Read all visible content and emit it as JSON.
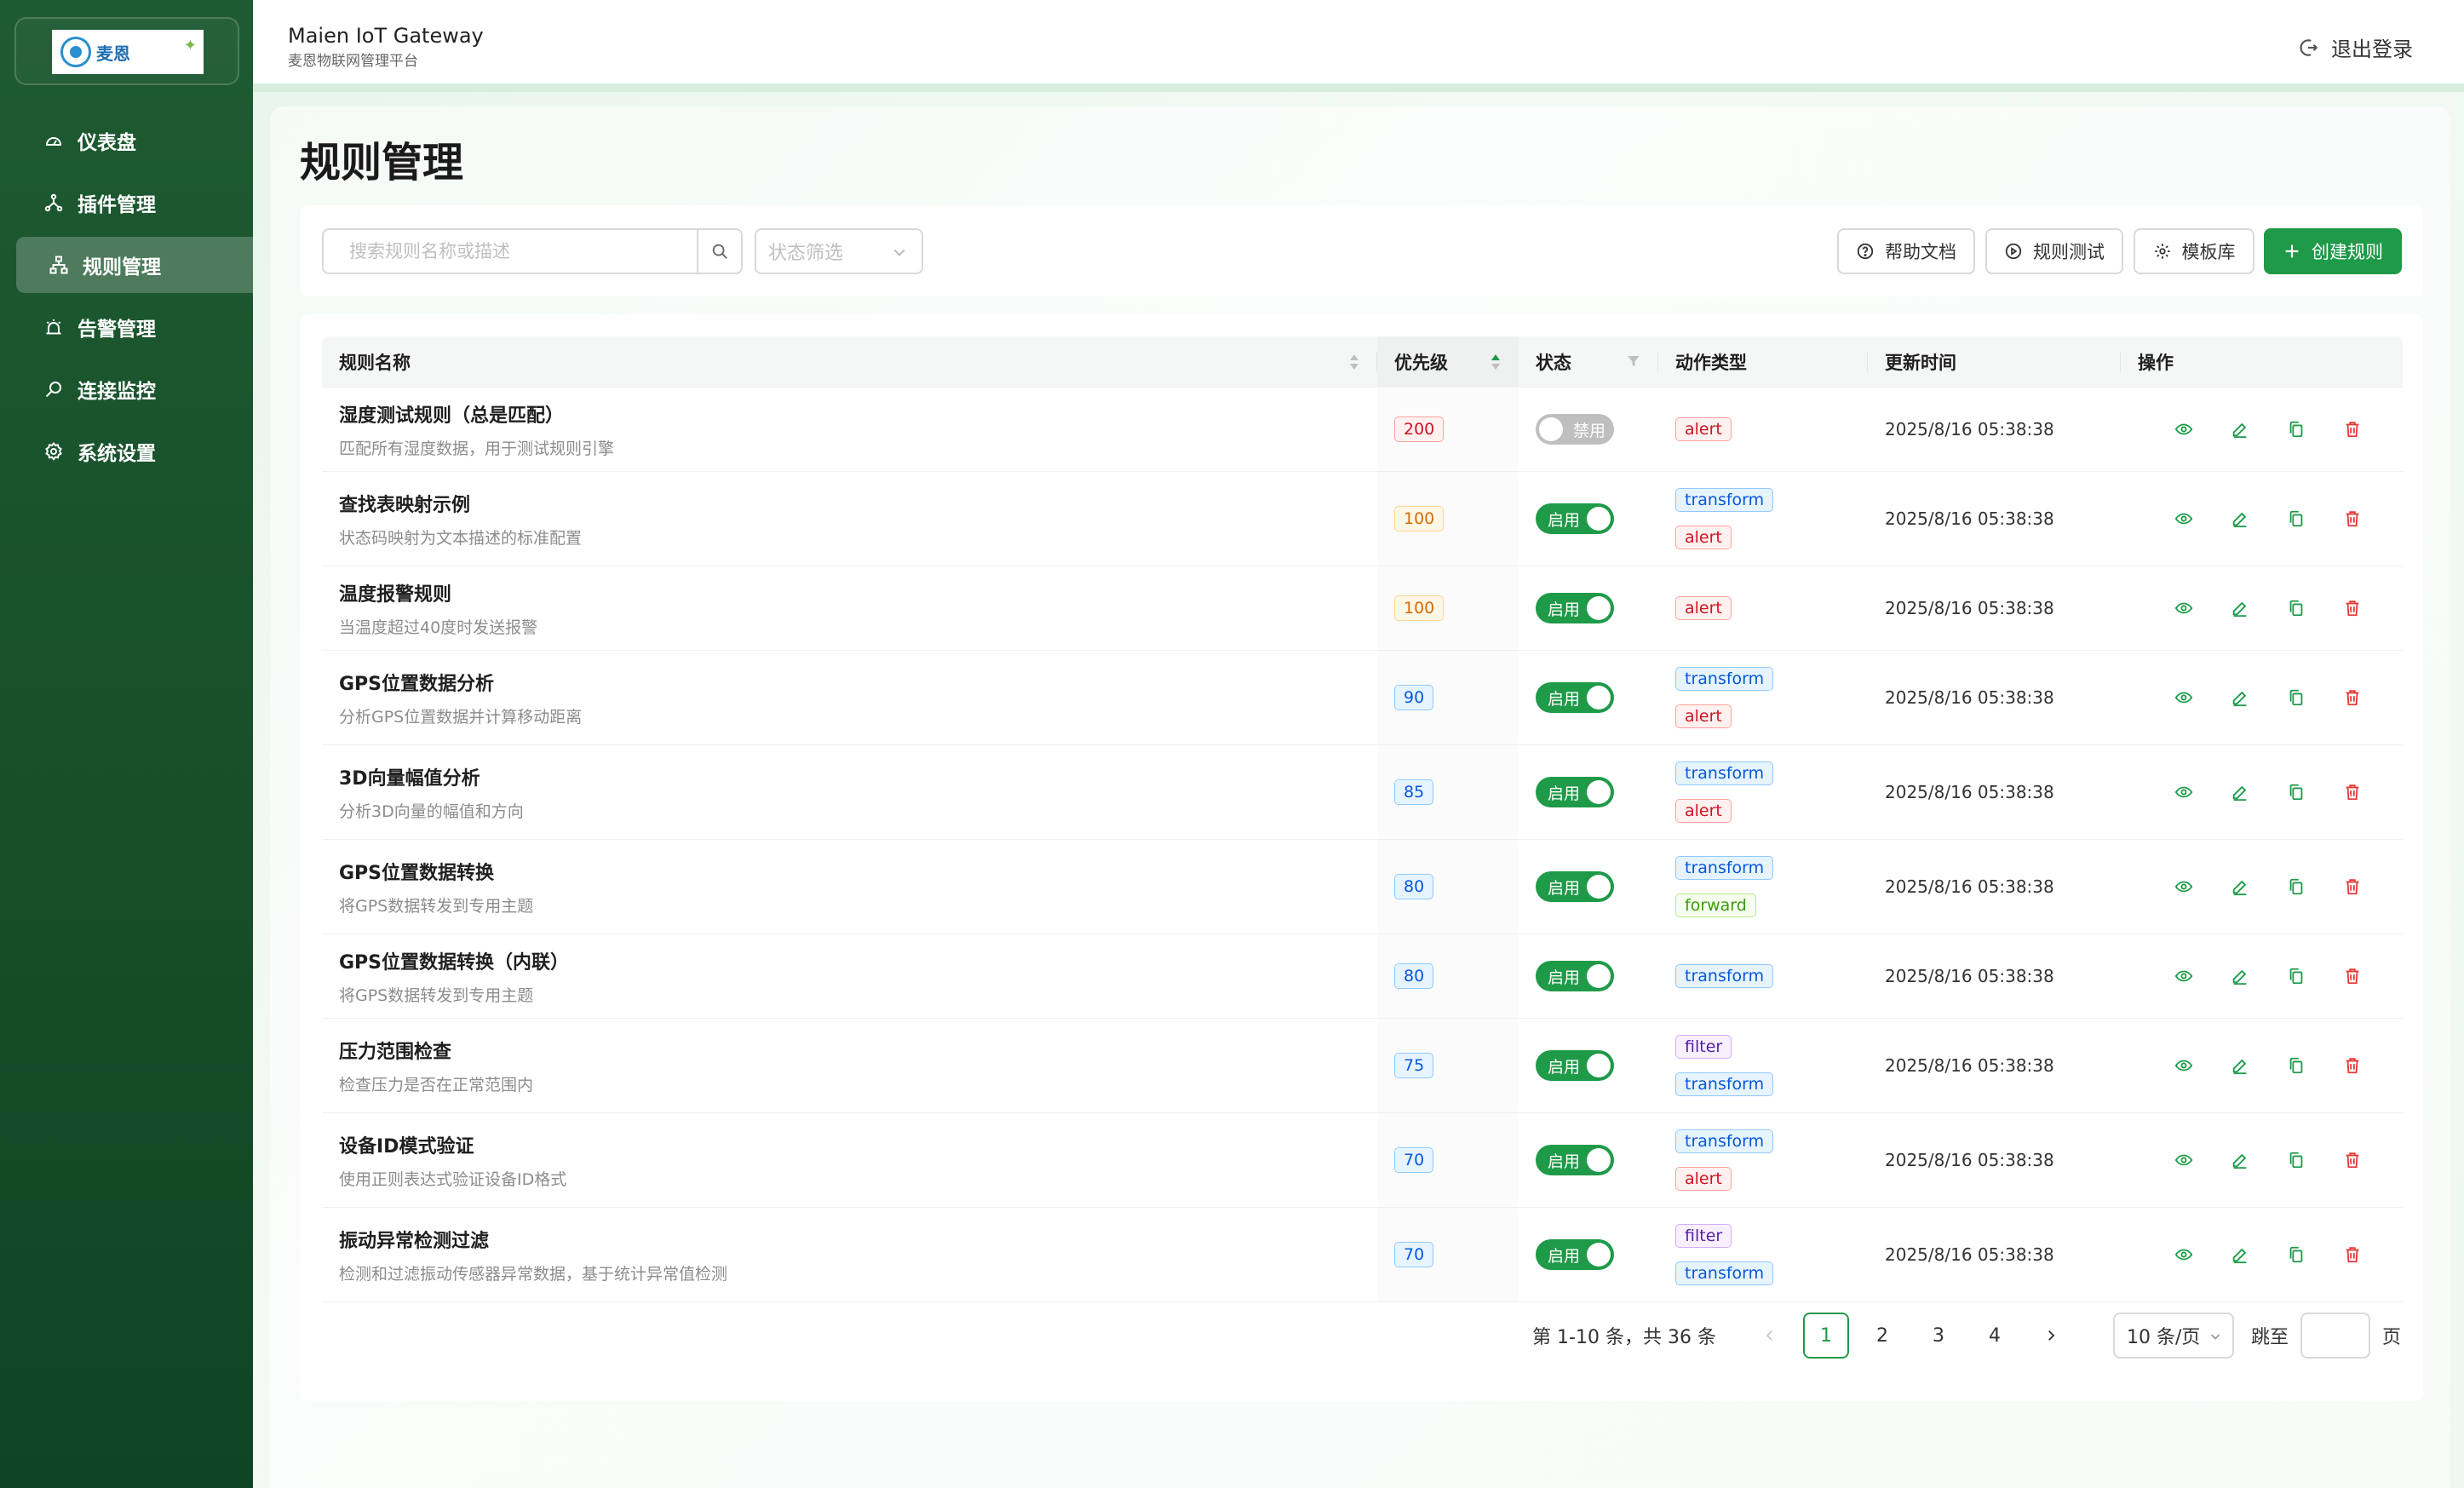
{
  "app": {
    "logo_text": "麦恩",
    "title": "Maien IoT Gateway",
    "subtitle": "麦恩物联网管理平台",
    "logout": "退出登录"
  },
  "sidebar": {
    "items": [
      {
        "label": "仪表盘",
        "icon": "dashboard-icon",
        "active": false
      },
      {
        "label": "插件管理",
        "icon": "plugin-icon",
        "active": false
      },
      {
        "label": "规则管理",
        "icon": "rules-icon",
        "active": true
      },
      {
        "label": "告警管理",
        "icon": "alarm-icon",
        "active": false
      },
      {
        "label": "连接监控",
        "icon": "monitor-icon",
        "active": false
      },
      {
        "label": "系统设置",
        "icon": "gear-icon",
        "active": false
      }
    ]
  },
  "page": {
    "title": "规则管理"
  },
  "toolbar": {
    "search_placeholder": "搜索规则名称或描述",
    "status_placeholder": "状态筛选",
    "help_label": "帮助文档",
    "test_label": "规则测试",
    "template_label": "模板库",
    "create_label": "创建规则"
  },
  "table": {
    "columns": {
      "name": "规则名称",
      "priority": "优先级",
      "status": "状态",
      "action_type": "动作类型",
      "updated": "更新时间",
      "ops": "操作"
    },
    "rows": [
      {
        "name": "湿度测试规则（总是匹配）",
        "desc": "匹配所有湿度数据，用于测试规则引擎",
        "priority": "200",
        "priority_color": "red",
        "enabled": false,
        "status_label": "禁用",
        "tags": [
          "alert"
        ],
        "updated": "2025/8/16 05:38:38"
      },
      {
        "name": "查找表映射示例",
        "desc": "状态码映射为文本描述的标准配置",
        "priority": "100",
        "priority_color": "orange",
        "enabled": true,
        "status_label": "启用",
        "tags": [
          "transform",
          "alert"
        ],
        "updated": "2025/8/16 05:38:38"
      },
      {
        "name": "温度报警规则",
        "desc": "当温度超过40度时发送报警",
        "priority": "100",
        "priority_color": "orange",
        "enabled": true,
        "status_label": "启用",
        "tags": [
          "alert"
        ],
        "updated": "2025/8/16 05:38:38"
      },
      {
        "name": "GPS位置数据分析",
        "desc": "分析GPS位置数据并计算移动距离",
        "priority": "90",
        "priority_color": "blue",
        "enabled": true,
        "status_label": "启用",
        "tags": [
          "transform",
          "alert"
        ],
        "updated": "2025/8/16 05:38:38"
      },
      {
        "name": "3D向量幅值分析",
        "desc": "分析3D向量的幅值和方向",
        "priority": "85",
        "priority_color": "blue",
        "enabled": true,
        "status_label": "启用",
        "tags": [
          "transform",
          "alert"
        ],
        "updated": "2025/8/16 05:38:38"
      },
      {
        "name": "GPS位置数据转换",
        "desc": "将GPS数据转发到专用主题",
        "priority": "80",
        "priority_color": "blue",
        "enabled": true,
        "status_label": "启用",
        "tags": [
          "transform",
          "forward"
        ],
        "updated": "2025/8/16 05:38:38"
      },
      {
        "name": "GPS位置数据转换（内联）",
        "desc": "将GPS数据转发到专用主题",
        "priority": "80",
        "priority_color": "blue",
        "enabled": true,
        "status_label": "启用",
        "tags": [
          "transform"
        ],
        "updated": "2025/8/16 05:38:38"
      },
      {
        "name": "压力范围检查",
        "desc": "检查压力是否在正常范围内",
        "priority": "75",
        "priority_color": "blue",
        "enabled": true,
        "status_label": "启用",
        "tags": [
          "filter",
          "transform"
        ],
        "updated": "2025/8/16 05:38:38"
      },
      {
        "name": "设备ID模式验证",
        "desc": "使用正则表达式验证设备ID格式",
        "priority": "70",
        "priority_color": "blue",
        "enabled": true,
        "status_label": "启用",
        "tags": [
          "transform",
          "alert"
        ],
        "updated": "2025/8/16 05:38:38"
      },
      {
        "name": "振动异常检测过滤",
        "desc": "检测和过滤振动传感器异常数据，基于统计异常值检测",
        "priority": "70",
        "priority_color": "blue",
        "enabled": true,
        "status_label": "启用",
        "tags": [
          "filter",
          "transform"
        ],
        "updated": "2025/8/16 05:38:38"
      }
    ]
  },
  "pagination": {
    "total_text": "第 1-10 条，共 36 条",
    "pages": [
      "1",
      "2",
      "3",
      "4"
    ],
    "current": "1",
    "page_size": "10 条/页",
    "jump_label": "跳至",
    "page_suffix": "页"
  },
  "colors": {
    "primary": "#1e9a48",
    "sidebar_bg": "#17502b",
    "danger": "#e53935"
  }
}
